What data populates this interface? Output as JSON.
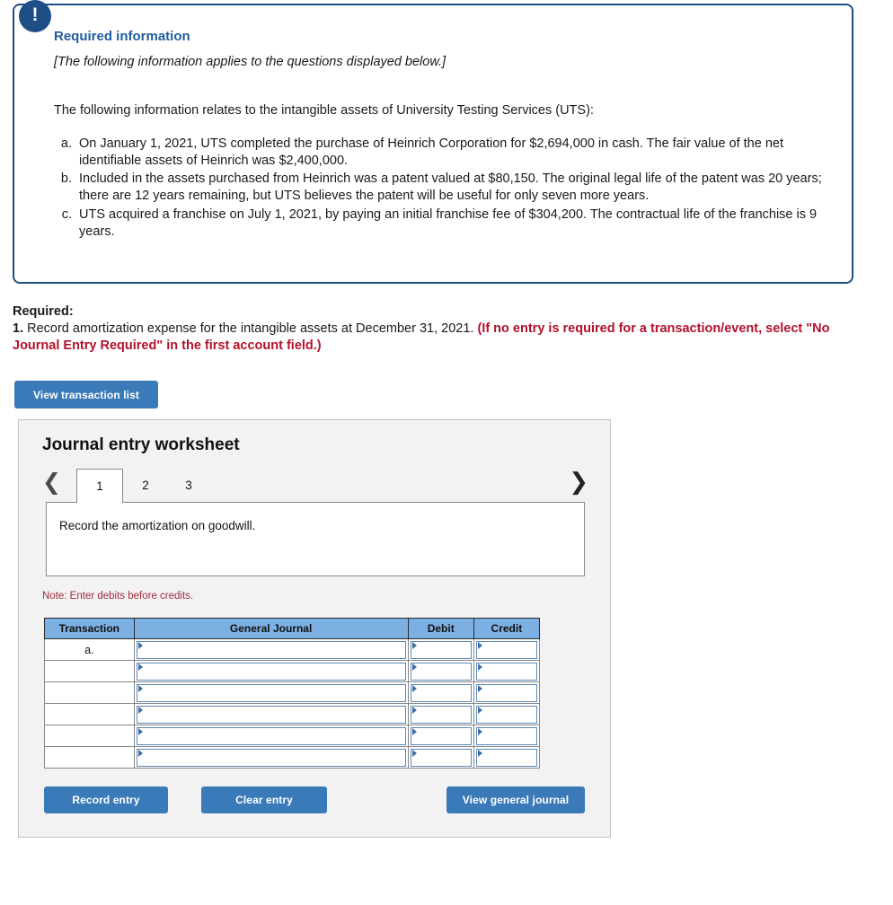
{
  "callout": {
    "badge_icon": "exclamation-icon",
    "title": "Required information",
    "italic_note": "[The following information applies to the questions displayed below.]",
    "lead": "The following information relates to the intangible assets of University Testing Services (UTS):",
    "facts": [
      "On January 1, 2021, UTS completed the purchase of Heinrich Corporation for $2,694,000 in cash. The fair value of the net identifiable assets of Heinrich was $2,400,000.",
      "Included in the assets purchased from Heinrich was a patent valued at $80,150. The original legal life of the patent was 20 years; there are 12 years remaining, but UTS believes the patent will be useful for only seven more years.",
      "UTS acquired a franchise on July 1, 2021, by paying an initial franchise fee of $304,200. The contractual life of the franchise is 9 years."
    ]
  },
  "required": {
    "label": "Required:",
    "item_number": "1.",
    "item_text": " Record amortization expense for the intangible assets at December 31, 2021. ",
    "emphasis": "(If no entry is required for a transaction/event, select \"No Journal Entry Required\" in the first account field.)"
  },
  "buttons": {
    "view_transaction_list": "View transaction list",
    "record_entry": "Record entry",
    "clear_entry": "Clear entry",
    "view_general_journal": "View general journal"
  },
  "worksheet": {
    "title": "Journal entry worksheet",
    "prev_icon": "chevron-left-icon",
    "next_icon": "chevron-right-icon",
    "tabs": [
      "1",
      "2",
      "3"
    ],
    "active_tab": "1",
    "description": "Record the amortization on goodwill.",
    "note": "Note: Enter debits before credits.",
    "table": {
      "headers": [
        "Transaction",
        "General Journal",
        "Debit",
        "Credit"
      ],
      "rows": [
        {
          "transaction": "a.",
          "general_journal": "",
          "debit": "",
          "credit": ""
        },
        {
          "transaction": "",
          "general_journal": "",
          "debit": "",
          "credit": ""
        },
        {
          "transaction": "",
          "general_journal": "",
          "debit": "",
          "credit": ""
        },
        {
          "transaction": "",
          "general_journal": "",
          "debit": "",
          "credit": ""
        },
        {
          "transaction": "",
          "general_journal": "",
          "debit": "",
          "credit": ""
        },
        {
          "transaction": "",
          "general_journal": "",
          "debit": "",
          "credit": ""
        }
      ]
    }
  },
  "colors": {
    "callout_border": "#1f4e87",
    "callout_title": "#1f5c9e",
    "button_blue": "#3b7ab8",
    "table_header_blue": "#7cb0e2",
    "warning_red": "#b3122a",
    "note_red": "#a02c3c",
    "panel_gray": "#f2f2f2"
  }
}
